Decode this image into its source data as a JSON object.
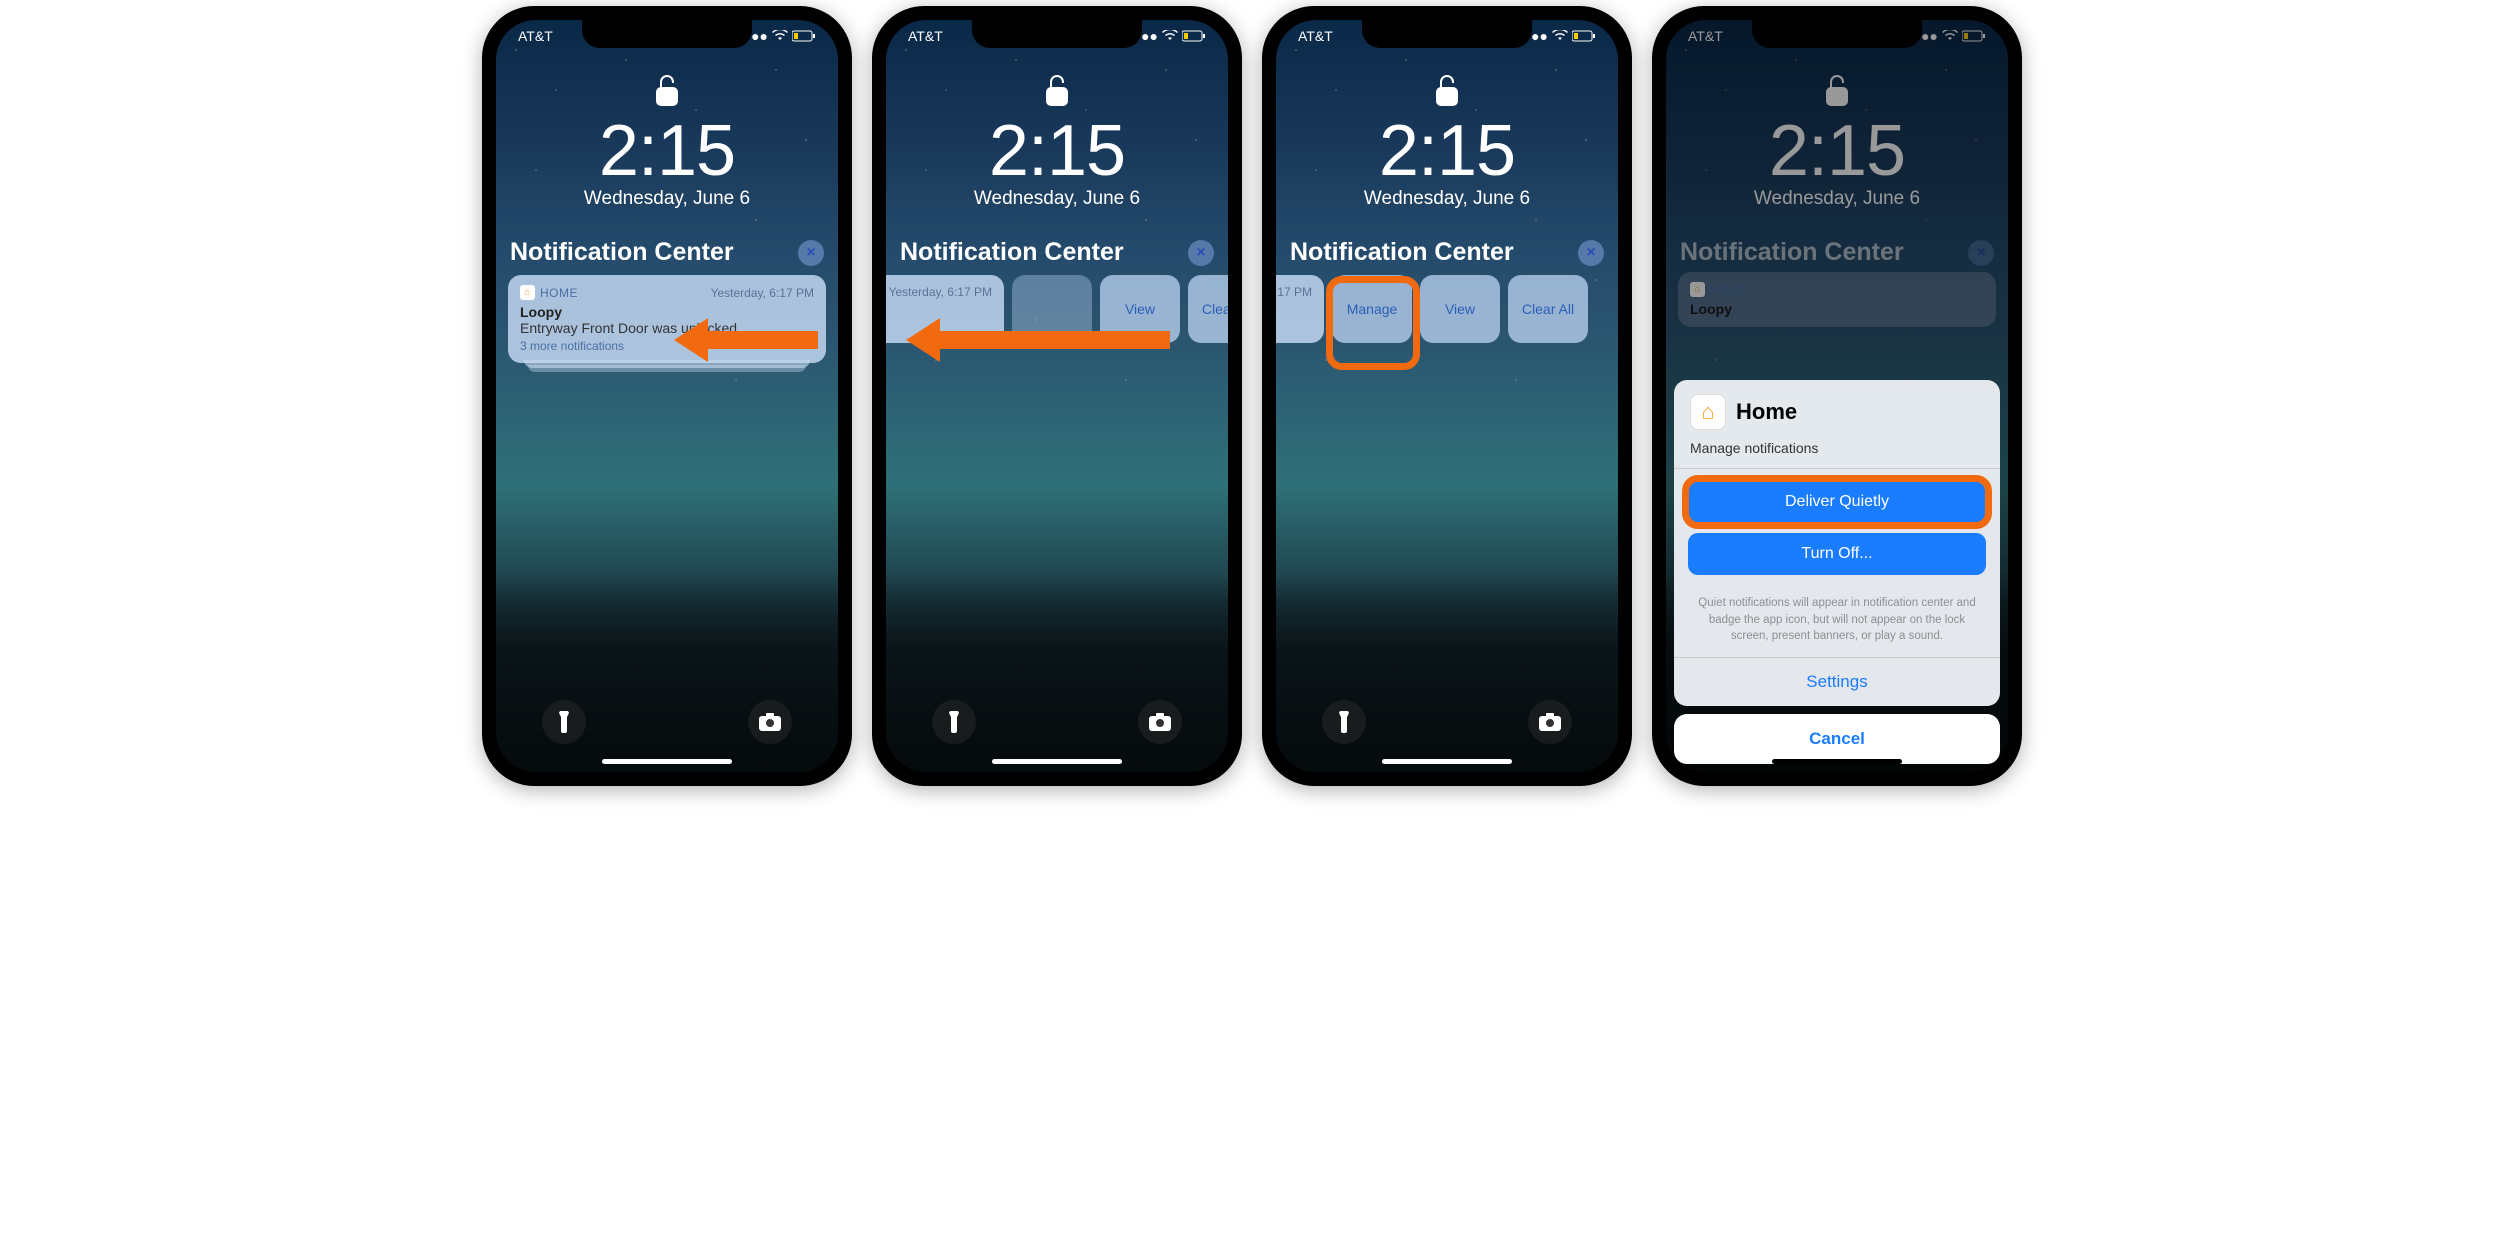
{
  "status": {
    "carrier": "AT&T"
  },
  "lock": {
    "time": "2:15",
    "date": "Wednesday, June 6"
  },
  "nc": {
    "title": "Notification Center",
    "close": "×"
  },
  "notif": {
    "app": "HOME",
    "time": "Yesterday, 6:17 PM",
    "title": "Loopy",
    "body": "Entryway Front Door was unlocked.",
    "more": "3 more notifications",
    "body_trunc": "d.",
    "time_trunc": "17 PM"
  },
  "actions": {
    "manage": "Manage",
    "view": "View",
    "clear": "Clear All"
  },
  "sheet": {
    "app": "Home",
    "sub": "Manage notifications",
    "deliver": "Deliver Quietly",
    "turnoff": "Turn Off...",
    "fine": "Quiet notifications will appear in notification center and badge the app icon, but will not appear on the lock screen, present banners, or play a sound.",
    "settings": "Settings",
    "cancel": "Cancel"
  }
}
